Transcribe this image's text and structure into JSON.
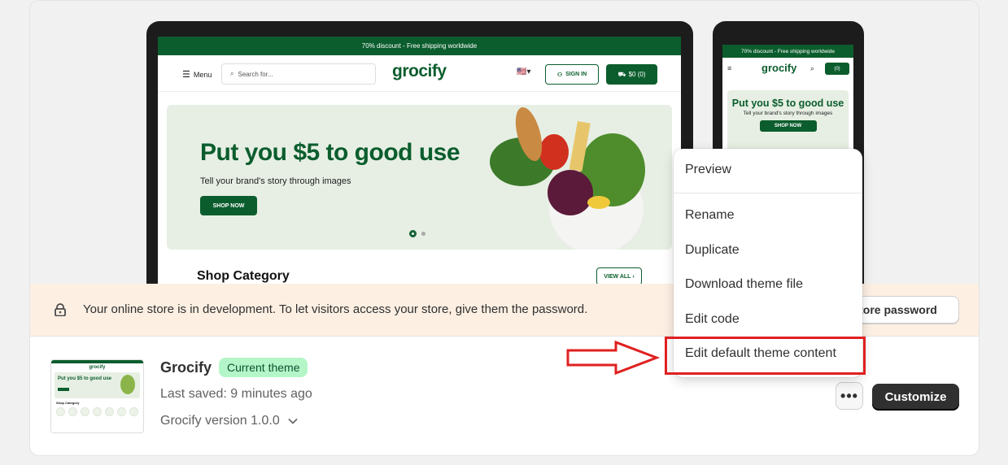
{
  "store_preview": {
    "announcement": "70% discount - Free shipping worldwide",
    "menu_label": "Menu",
    "search_placeholder": "Search for...",
    "logo": "grocify",
    "signin_label": "SIGN IN",
    "cart_label": "$0 (0)",
    "hero_title": "Put you $5 to good use",
    "hero_subtitle": "Tell your brand's story through images",
    "shop_now": "SHOP NOW",
    "section_title": "Shop Category",
    "view_all": "VIEW ALL"
  },
  "mobile_preview": {
    "announcement": "70% discount - Free shipping worldwide",
    "logo": "grocify",
    "cart_label": "(0)",
    "hero_title": "Put you $5 to good use",
    "hero_subtitle": "Tell your brand's story through images",
    "shop_now": "SHOP NOW"
  },
  "banner": {
    "message": "Your online store is in development. To let visitors access your store, give them the password.",
    "button_label": "tore password"
  },
  "theme": {
    "name": "Grocify",
    "badge": "Current theme",
    "last_saved": "Last saved: 9 minutes ago",
    "version": "Grocify version 1.0.0",
    "customize_label": "Customize",
    "more_label": "•••",
    "thumb_logo": "grocify",
    "thumb_hero": "Put you $5 to good use",
    "thumb_section": "Shop Category"
  },
  "actions_menu": {
    "items": [
      "Preview",
      "Rename",
      "Duplicate",
      "Download theme file",
      "Edit code",
      "Edit default theme content"
    ]
  },
  "colors": {
    "brand_green": "#0b5d2d",
    "badge_bg": "#b4f6c7",
    "banner_bg": "#fdf0e3",
    "highlight": "#e02020"
  },
  "icons": {
    "banner": "lock-icon",
    "more": "ellipsis-icon",
    "version": "chevron-down-icon",
    "annotation": "red-arrow-icon"
  }
}
